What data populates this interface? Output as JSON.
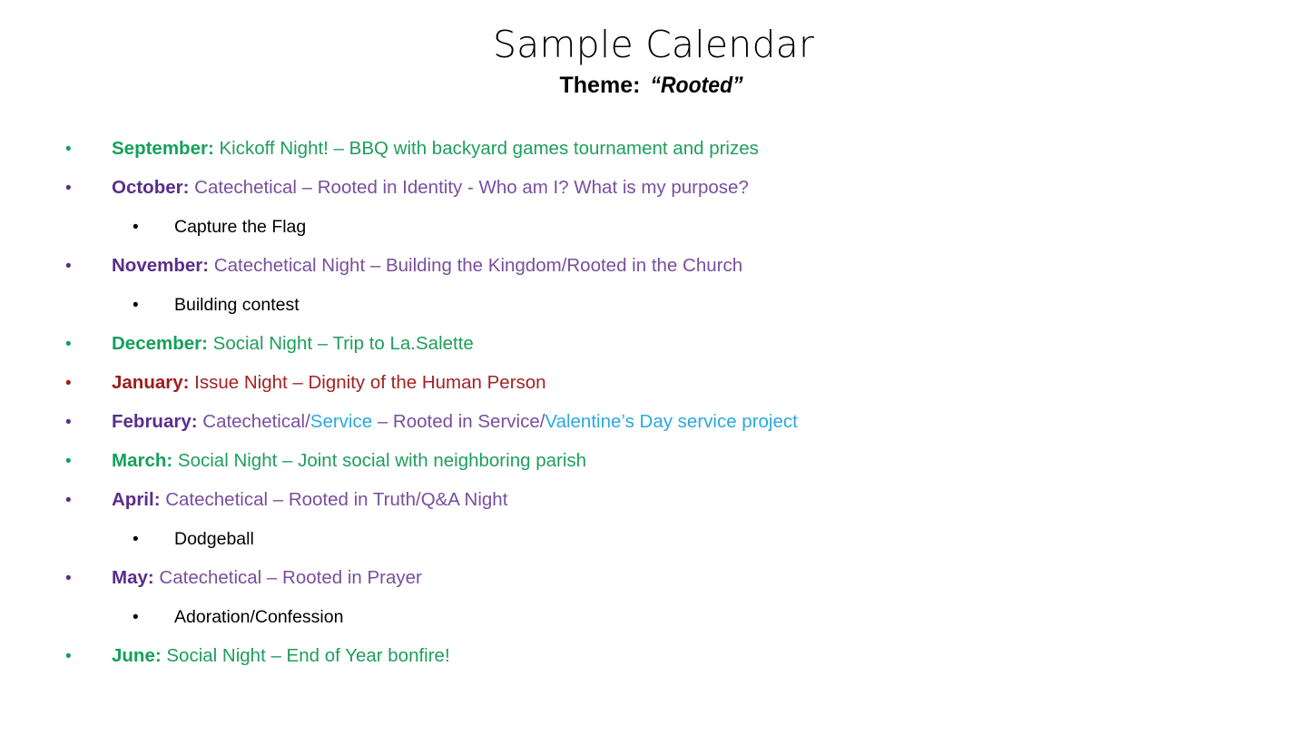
{
  "slide": {
    "title": "Sample Calendar",
    "subtitle_label": "Theme:",
    "subtitle_value": "“Rooted”",
    "background": "#ffffff"
  },
  "colors": {
    "green_bold": "#14a05a",
    "green_text": "#1f9e5c",
    "purple_bold": "#5a2d8c",
    "purple_text": "#7a4e9e",
    "red_bold": "#9e1b1b",
    "red_text": "#a52222",
    "blue_text": "#2ba8de",
    "black": "#000000"
  },
  "bullets": [
    {
      "level": 1,
      "bullet_char": "•",
      "bullet_color": "#14a05a",
      "month": "September:",
      "month_color": "#14a05a",
      "text": " Kickoff Night! – BBQ with backyard games tournament and prizes",
      "text_color": "#1f9e5c"
    },
    {
      "level": 1,
      "bullet_char": "•",
      "bullet_color": "#5a2d8c",
      "month": "October:",
      "month_color": "#5a2d8c",
      "text": " Catechetical – Rooted in Identity - Who am I? What is my purpose?",
      "text_color": "#7a4e9e"
    },
    {
      "level": 2,
      "bullet_char": "•",
      "bullet_color": "#000000",
      "month": "",
      "month_color": "#000000",
      "text": "Capture the Flag",
      "text_color": "#000000"
    },
    {
      "level": 1,
      "bullet_char": "•",
      "bullet_color": "#5a2d8c",
      "month": "November:",
      "month_color": "#5a2d8c",
      "text": " Catechetical Night – Building the Kingdom/Rooted in the Church",
      "text_color": "#7a4e9e"
    },
    {
      "level": 2,
      "bullet_char": "•",
      "bullet_color": "#000000",
      "month": "",
      "month_color": "#000000",
      "text": "Building contest",
      "text_color": "#000000"
    },
    {
      "level": 1,
      "bullet_char": "•",
      "bullet_color": "#14a05a",
      "month": "December:",
      "month_color": "#14a05a",
      "text": " Social Night – Trip to La.Salette",
      "text_color": "#1f9e5c"
    },
    {
      "level": 1,
      "bullet_char": "•",
      "bullet_color": "#9e1b1b",
      "month": "January:",
      "month_color": "#9e1b1b",
      "text": " Issue Night – Dignity of the Human Person",
      "text_color": "#a52222"
    },
    {
      "level": 1,
      "bullet_char": "•",
      "bullet_color": "#5a2d8c",
      "month": "February:",
      "month_color": "#5a2d8c",
      "text": " Catechetical/",
      "text_color": "#7a4e9e",
      "runs": [
        {
          "text": " Catechetical/",
          "color": "#7a4e9e"
        },
        {
          "text": "Service",
          "color": "#2ba8de"
        },
        {
          "text": " – Rooted in Service/",
          "color": "#7a4e9e"
        },
        {
          "text": "Valentine’s Day service project",
          "color": "#2ba8de"
        }
      ]
    },
    {
      "level": 1,
      "bullet_char": "•",
      "bullet_color": "#14a05a",
      "month": "March:",
      "month_color": "#14a05a",
      "text": " Social Night – Joint social with neighboring parish",
      "text_color": "#1f9e5c"
    },
    {
      "level": 1,
      "bullet_char": "•",
      "bullet_color": "#5a2d8c",
      "month": "April:",
      "month_color": "#5a2d8c",
      "text": " Catechetical – Rooted in Truth/Q&A Night",
      "text_color": "#7a4e9e"
    },
    {
      "level": 2,
      "bullet_char": "•",
      "bullet_color": "#000000",
      "month": "",
      "month_color": "#000000",
      "text": "Dodgeball",
      "text_color": "#000000"
    },
    {
      "level": 1,
      "bullet_char": "•",
      "bullet_color": "#5a2d8c",
      "month": "May:",
      "month_color": "#5a2d8c",
      "text": " Catechetical – Rooted in Prayer",
      "text_color": "#7a4e9e"
    },
    {
      "level": 2,
      "bullet_char": "•",
      "bullet_color": "#000000",
      "month": "",
      "month_color": "#000000",
      "text": "Adoration/Confession",
      "text_color": "#000000"
    },
    {
      "level": 1,
      "bullet_char": "•",
      "bullet_color": "#14a05a",
      "month": "June:",
      "month_color": "#14a05a",
      "text": " Social Night – End of Year bonfire!",
      "text_color": "#1f9e5c"
    }
  ]
}
